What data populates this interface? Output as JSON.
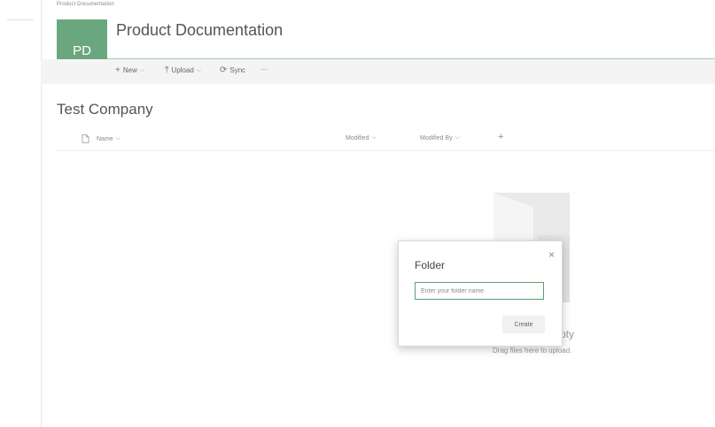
{
  "breadcrumb": "Product Documentation",
  "site": {
    "logo_text": "PD",
    "title": "Product Documentation",
    "accent_color": "#6aa77f"
  },
  "commands": {
    "new_label": "New",
    "upload_label": "Upload",
    "sync_label": "Sync",
    "more_label": "···"
  },
  "library": {
    "title": "Test Company",
    "columns": {
      "name": "Name",
      "modified": "Modified",
      "modified_by": "Modified By",
      "add": "+"
    },
    "empty": {
      "title": "pty",
      "subtitle": "Drag files here to upload."
    }
  },
  "dialog": {
    "title": "Folder",
    "close": "×",
    "input_placeholder": "Enter your folder name",
    "input_value": "",
    "create_label": "Create"
  }
}
